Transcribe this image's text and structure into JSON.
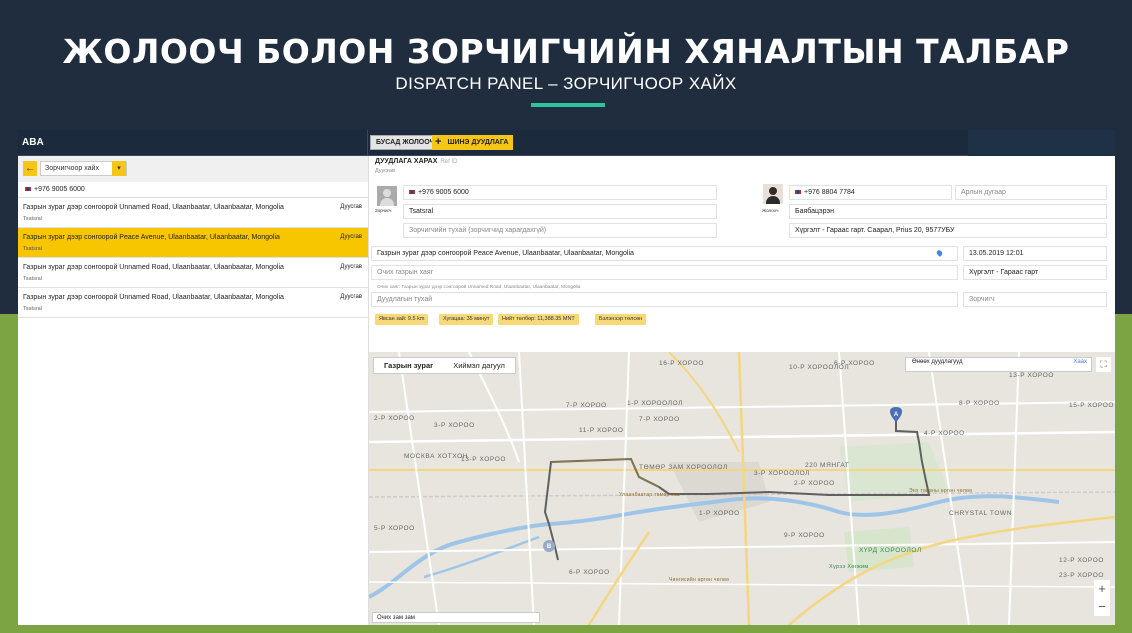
{
  "slide": {
    "title": "ЖОЛООЧ БОЛОН ЗОРЧИГЧИЙН ХЯНАЛТЫН ТАЛБАР",
    "subtitle": "DISPATCH PANEL – ЗОРЧИГЧООР ХАЙХ",
    "accent_color": "#2fc39e"
  },
  "app": {
    "brand": "ABA",
    "buttons": {
      "other_drivers": "БУСАД ЖОЛООЧ",
      "new_call": "ШИНЭ ДУУДЛАГА",
      "new_call_icon": "+"
    }
  },
  "search": {
    "back_icon": "←",
    "mode": "Зорчигчоор хайх",
    "dropdown_icon": "▾",
    "phone": "+976 9005 6000"
  },
  "rides": [
    {
      "address": "Газрын зураг дээр сонгоорой Unnamed Road, Ulaanbaatar, Ulaanbaatar, Mongolia",
      "name": "Tsatsral",
      "status": "Дуусгав",
      "active": false
    },
    {
      "address": "Газрын зураг дээр сонгоорой Peace Avenue, Ulaanbaatar, Ulaanbaatar, Mongolia",
      "name": "Tsatsral",
      "status": "Дуусгав",
      "active": true
    },
    {
      "address": "Газрын зураг дээр сонгоорой Unnamed Road, Ulaanbaatar, Ulaanbaatar, Mongolia",
      "name": "Tsatsral",
      "status": "Дуусгав",
      "active": false
    },
    {
      "address": "Газрын зураг дээр сонгоорой Unnamed Road, Ulaanbaatar, Ulaanbaatar, Mongolia",
      "name": "Tsatsral",
      "status": "Дуусгав",
      "active": false
    }
  ],
  "detail": {
    "title": "ДУУДЛАГА ХАРАХ",
    "id_label": "Ref ID",
    "status": "Дуусгав",
    "passenger": {
      "label": "Зорчигч",
      "phone": "+976 9005 6000",
      "name": "Tsatsral",
      "note_placeholder": "Зорчигчийн тухай (зорчигчид харагдахгүй)"
    },
    "driver": {
      "label": "Жолооч",
      "phone": "+976 8804 7784",
      "name": "Баябацэрэн",
      "vehicle": "Хүргэлт - Гараас гарт. Саарал, Prius 20, 9577УБУ",
      "extra_placeholder": "Арлын дугаар"
    },
    "pickup": "Газрын зураг дээр сонгоорой Peace Avenue, Ulaanbaatar, Ulaanbaatar, Mongolia",
    "datetime": "13.05.2019 12:01",
    "dest_placeholder": "Очих газрын хаяг",
    "dest_hint": "Очих хаяг: Газрын зураг дээр сонгоорой Unnamed Road, Ulaanbaatar, Ulaanbaatar, Mongolia",
    "service": "Хүргэлт - Гараас гарт",
    "call_note_placeholder": "Дуудлагын тухай",
    "role": "Зорчигч",
    "chips": [
      "Явсан зай: 9.5 km",
      "Хугацаа: 35 минут",
      "Нийт төлбөр: 11,388.35 MNT",
      "Бэлэнээр төлсөн"
    ]
  },
  "map": {
    "tabs": [
      "Газрын зураг",
      "Хиймэл дагуул"
    ],
    "traffic_label": "Өнөөх дуудлагууд",
    "traffic_close": "Хаах",
    "fullscreen_icon": "⛶",
    "zoom_in": "+",
    "zoom_out": "−",
    "road_select": "Очих зам зам",
    "marker_a": "A",
    "marker_b": "B",
    "labels": {
      "l1": "16-Р ХОРОО",
      "l2": "6-Р ХОРОО",
      "l3": "10-Р ХОРООЛОЛ",
      "l4": "7-Р ХОРОО",
      "l5": "1-Р ХОРООЛОЛ",
      "l6": "2-Р ХОРОО",
      "l7": "3-Р ХОРОО",
      "l8": "11-Р ХОРОО",
      "l9": "13-Р ХОРОО",
      "l10": "МОСКВА ХОТХОН",
      "l11": "ТӨМӨР ЗАМ ХОРООЛОЛ",
      "l12": "220 МЯНГАТ",
      "l13": "3-Р ХОРООЛОЛ",
      "l14": "2-Р ХОРОО",
      "l15": "CHRYSTAL TOWN",
      "l16": "1-Р ХОРОО",
      "l17": "5-Р ХОРОО",
      "l18": "9-Р ХОРОО",
      "l19": "ХҮРД ХОРООЛОЛ",
      "l20": "12-Р ХОРОО",
      "l21": "13-Р ХОРОО",
      "l22": "15-Р ХОРОО",
      "l23": "23-Р ХОРОО",
      "l24": "Улаанбаатар төмөр зам",
      "l25": "Чингисийн өргөн чөлөө",
      "l26": "Энх тайвны өргөн чөлөө",
      "l27": "Хүрээ Хөгжим",
      "l28": "7-Р ХОРОО",
      "l29": "4-Р ХОРОО",
      "l30": "8-Р ХОРОО",
      "l31": "6-Р ХОРОО"
    }
  }
}
